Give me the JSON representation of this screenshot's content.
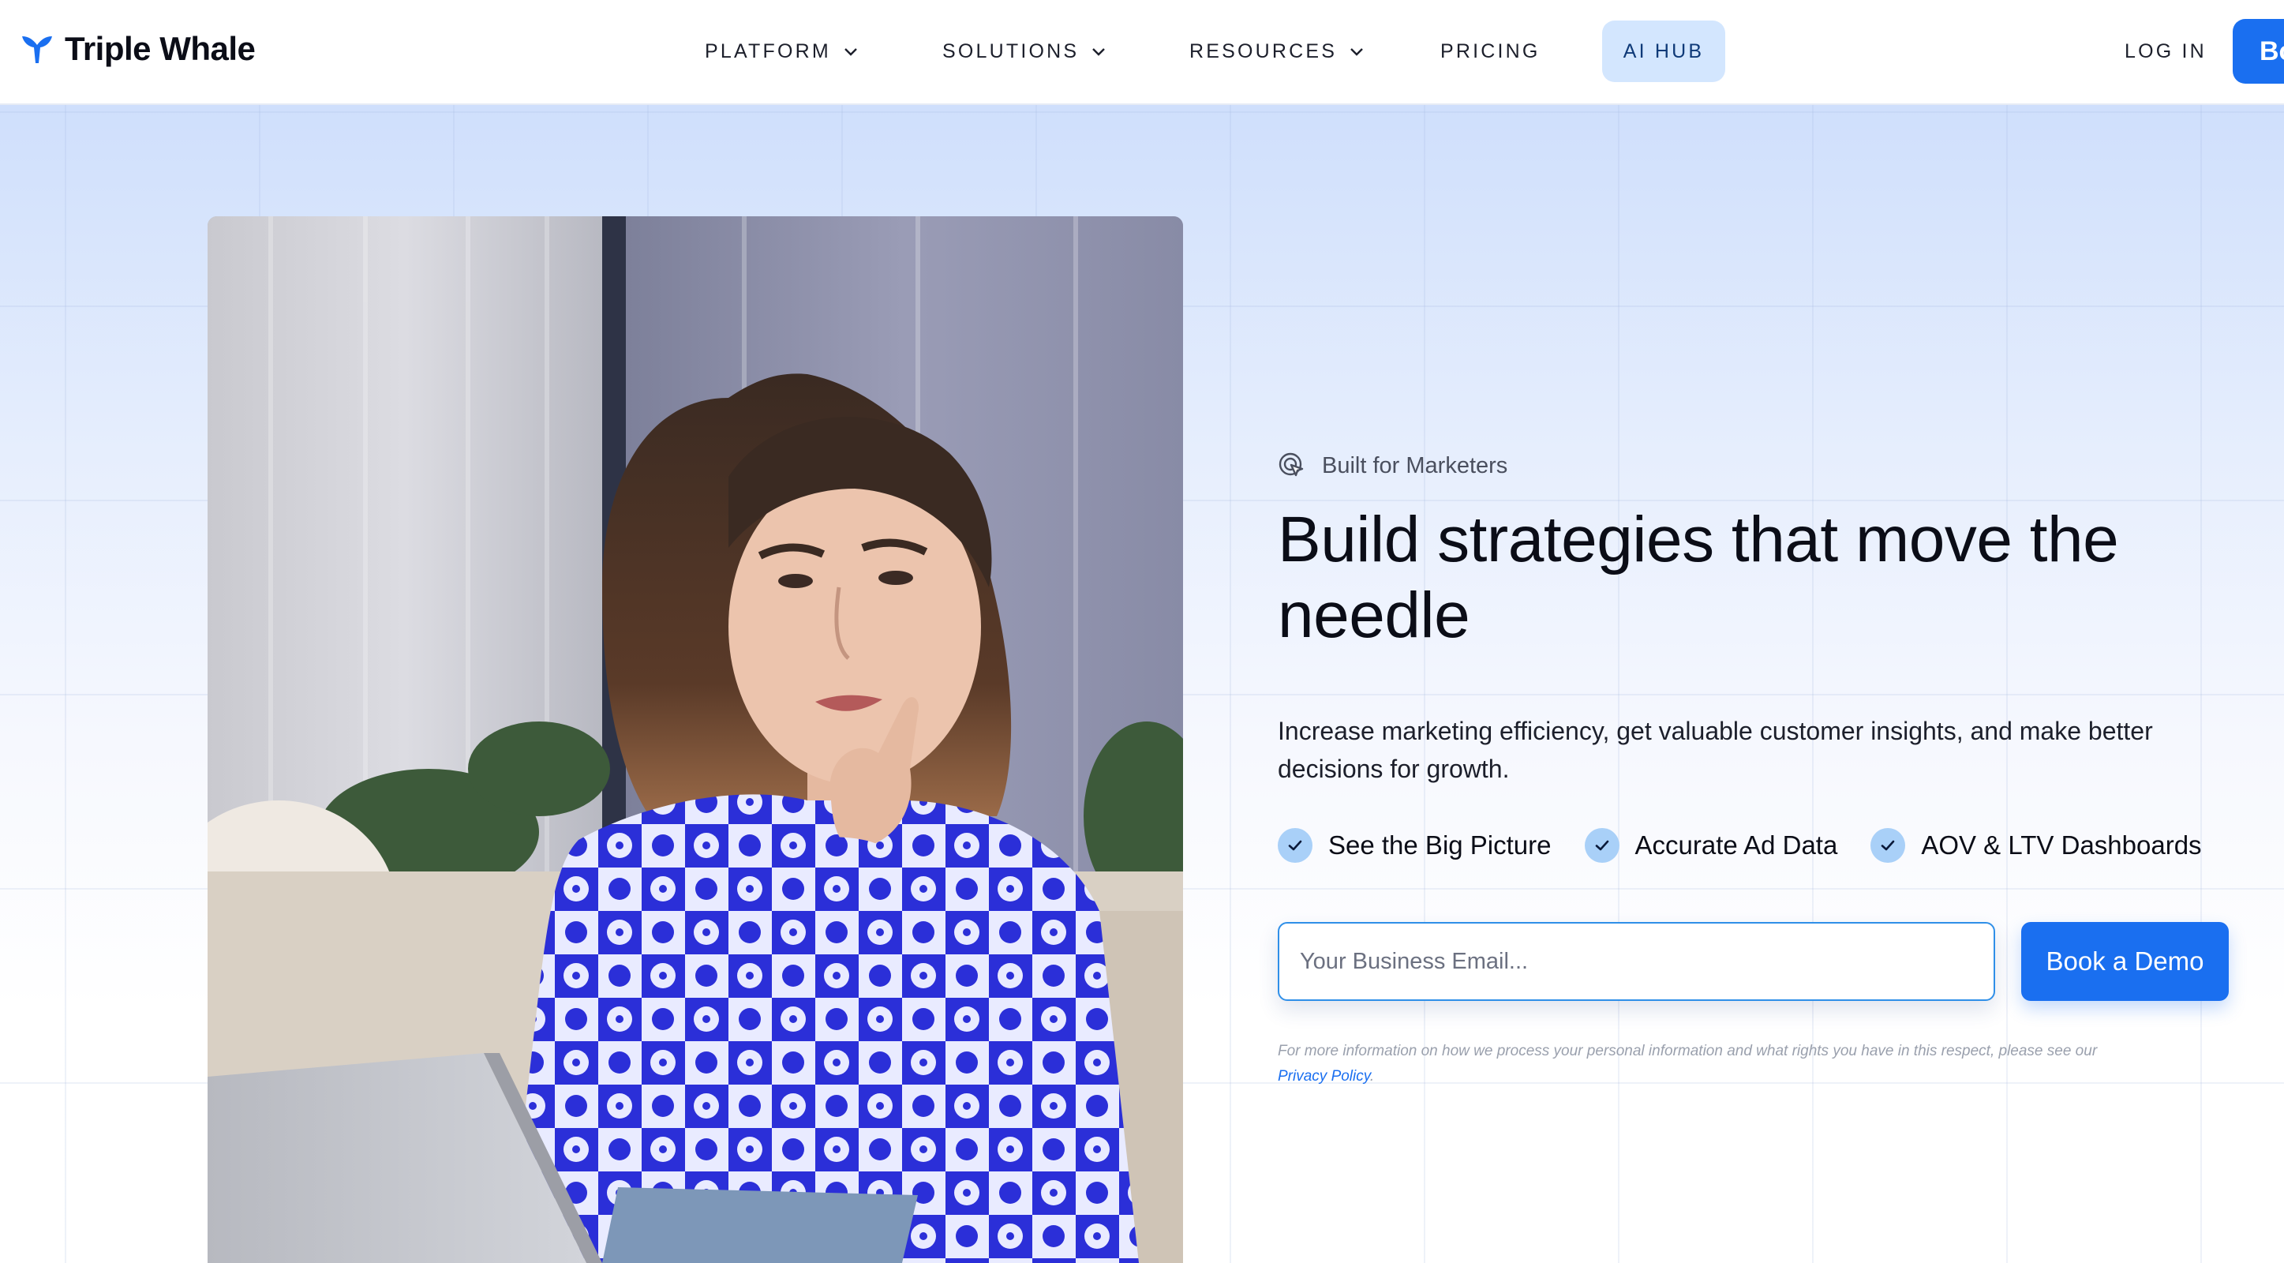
{
  "brand": {
    "name": "Triple Whale",
    "logo_icon": "whale-tail-icon",
    "accent": "#1a6ff0"
  },
  "nav": {
    "items": [
      {
        "label": "PLATFORM",
        "has_dropdown": true
      },
      {
        "label": "SOLUTIONS",
        "has_dropdown": true
      },
      {
        "label": "RESOURCES",
        "has_dropdown": true
      },
      {
        "label": "PRICING",
        "has_dropdown": false
      },
      {
        "label": "AI HUB",
        "has_dropdown": false
      }
    ],
    "login": "LOG IN",
    "cta_partial": "Bo"
  },
  "hero": {
    "eyebrow": "Built for Marketers",
    "eyebrow_icon": "target-cursor-icon",
    "headline": "Build strategies that move the needle",
    "subtext": "Increase marketing efficiency, get valuable customer insights, and make better decisions for growth.",
    "features": [
      {
        "label": "See the Big Picture",
        "icon": "check-icon"
      },
      {
        "label": "Accurate Ad Data",
        "icon": "check-icon"
      },
      {
        "label": "AOV & LTV Dashboards",
        "icon": "check-icon"
      }
    ],
    "email_placeholder": "Your Business Email...",
    "email_value": "",
    "cta": "Book a Demo",
    "legal_text": "For more information on how we process your personal information and what rights you have in this respect, please see our",
    "legal_link": "Privacy Policy",
    "legal_end": "."
  },
  "colors": {
    "check_bg": "#a9d0f8",
    "ai_hub_bg": "#d3e6fe",
    "input_border": "#2f8fe8"
  }
}
